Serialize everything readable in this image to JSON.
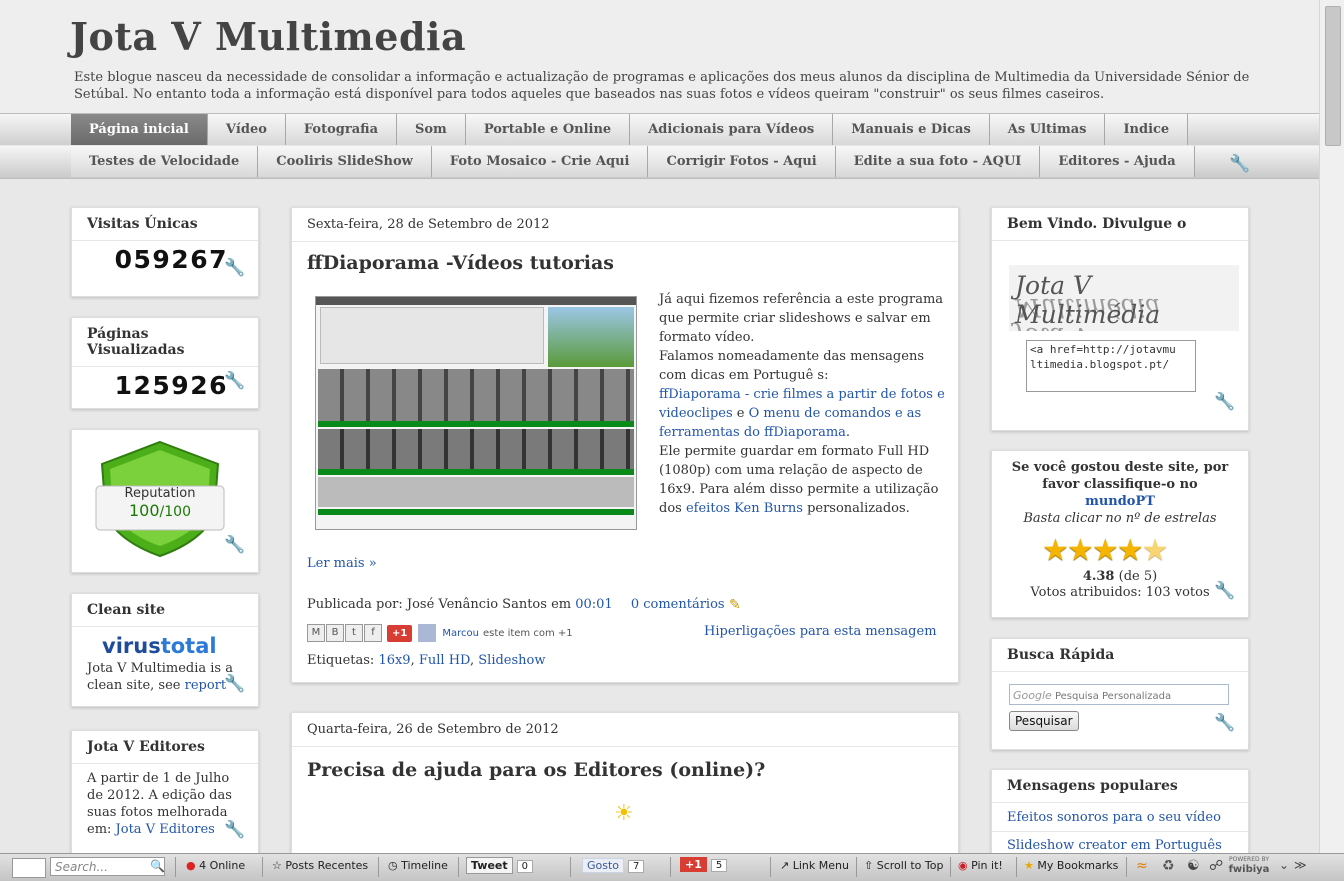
{
  "header": {
    "title": "Jota V Multimedia",
    "description": "Este blogue nasceu da necessidade de consolidar a informação e actualização de programas e aplicações dos meus alunos da disciplina de Multimedia da Universidade Sénior de Setúbal. No entanto toda a informação está disponível para todos aqueles que baseados nas suas fotos e vídeos queiram \"construir\" os seus filmes caseiros."
  },
  "nav": {
    "row1": [
      "Página inicial",
      "Vídeo",
      "Fotografia",
      "Som",
      "Portable e Online",
      "Adicionais para Vídeos",
      "Manuais e Dicas",
      "As Ultimas",
      "Indice"
    ],
    "row2": [
      "Testes de Velocidade",
      "Cooliris SlideShow",
      "Foto Mosaico - Crie Aqui",
      "Corrigir Fotos - Aqui",
      "Edite a sua foto - AQUI",
      "Editores - Ajuda"
    ]
  },
  "left": {
    "visitas_title": "Visitas Únicas",
    "visitas_count": "059267",
    "paginas_title": "Páginas Visualizadas",
    "paginas_count": "125926",
    "reputation_label": "Reputation",
    "reputation_score": "100",
    "reputation_max": "/100",
    "clean_title": "Clean site",
    "virustotal_a": "virus",
    "virustotal_b": "total",
    "clean_text": "Jota V Multimedia is a clean site, see",
    "clean_link": "report",
    "editores_title": "Jota V Editores",
    "editores_text": "A partir de 1 de Julho de 2012. A edição das suas fotos melhorada em:",
    "editores_link": "Jota V Editores"
  },
  "post1": {
    "date": "Sexta-feira, 28 de Setembro de 2012",
    "title": "ffDiaporama -Vídeos tutorias",
    "p1": "Já aqui fizemos referência a este programa que permite criar slideshows e salvar em formato vídeo.",
    "p2": "Falamos nomeadamente das mensagens com dicas em Portuguê s:",
    "link1": "ffDiaporama - crie filmes a partir de fotos e videoclipes",
    "and": " e ",
    "link2": "O menu de comandos e as ferramentas do ffDiaporama",
    "dot": ".",
    "p3": "Ele permite guardar em formato Full HD (1080p) com uma relação de aspecto de 16x9. Para além disso permite a utilização dos",
    "link3": "efeitos Ken Burns",
    "p3b": " personalizados.",
    "read_more": "Ler mais »",
    "posted_by": "Publicada por: José Venâncio Santos em",
    "time": "00:01",
    "comments": "0 comentários",
    "gplus": "+1",
    "marcou": "Marcou",
    "marcou_text": "este item com +1",
    "backlinks": "Hiperligações para esta mensagem",
    "labels_title": "Etiquetas:",
    "labels": [
      "16x9",
      "Full HD",
      "Slideshow"
    ]
  },
  "post2": {
    "date": "Quarta-feira, 26 de Setembro de 2012",
    "title": "Precisa de ajuda para os Editores (online)?"
  },
  "right": {
    "welcome_title": "Bem Vindo. Divulgue o",
    "logo_text": "Jota V Multimédia",
    "code_text": "<a href=http://jotavmultimedia.blogspot.pt/",
    "rate_text": "Se você gostou deste site, por favor classifique-o no",
    "rate_link": "mundoPT",
    "rate_hint": "Basta clicar no nº de estrelas",
    "rating_value": 4.38,
    "rating_score": "4.38",
    "rating_of": " (de 5)",
    "votes": "Votos atribuidos: 103 votos",
    "search_title": "Busca Rápida",
    "search_placeholder": "Pesquisa Personalizada",
    "google": "Google",
    "search_button": "Pesquisar",
    "popular_title": "Mensagens populares",
    "popular": [
      "Efeitos sonoros para o seu vídeo",
      "Slideshow creator em Português e"
    ]
  },
  "toolbar": {
    "search_placeholder": "Search...",
    "online": "4 Online",
    "recent": "Posts Recentes",
    "timeline": "Timeline",
    "tweet": "Tweet",
    "tweet_count": "0",
    "fb": "Gosto",
    "fb_count": "7",
    "gplus": "+1",
    "gplus_count": "5",
    "linkmenu": "Link Menu",
    "scrolltop": "Scroll to Top",
    "pinit": "Pin it!",
    "bookmarks": "My Bookmarks",
    "powered": "POWERED BY",
    "brand": "fwibiya"
  },
  "colors": {
    "link": "#2255aa",
    "nav_active": "#777777",
    "shield_green": "#66cc22"
  }
}
